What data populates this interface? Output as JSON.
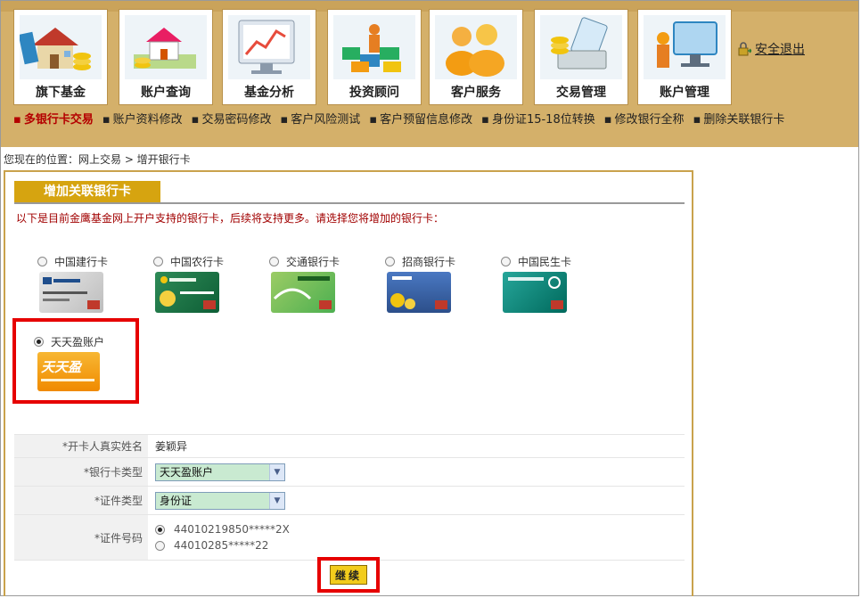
{
  "nav": {
    "tabs": [
      {
        "label": "旗下基金",
        "icon": "fund-house-icon"
      },
      {
        "label": "账户查询",
        "icon": "account-query-icon"
      },
      {
        "label": "基金分析",
        "icon": "chart-analysis-icon"
      },
      {
        "label": "投资顾问",
        "icon": "advisor-icon"
      },
      {
        "label": "客户服务",
        "icon": "customer-service-icon"
      },
      {
        "label": "交易管理",
        "icon": "trade-management-icon"
      },
      {
        "label": "账户管理",
        "icon": "account-management-icon"
      }
    ],
    "logout": "安全退出",
    "sub_items": [
      "多银行卡交易",
      "账户资料修改",
      "交易密码修改",
      "客户风险测试",
      "客户预留信息修改",
      "身份证15-18位转换",
      "修改银行全称",
      "删除关联银行卡"
    ]
  },
  "breadcrumb": "您现在的位置：网上交易  > 增开银行卡",
  "section": {
    "title": "增加关联银行卡",
    "intro": "以下是目前金鹰基金网上开户支持的银行卡，后续将支持更多。请选择您将增加的银行卡："
  },
  "cards": [
    {
      "label": "中国建行卡",
      "selected": false
    },
    {
      "label": "中国农行卡",
      "selected": false
    },
    {
      "label": "交通银行卡",
      "selected": false
    },
    {
      "label": "招商银行卡",
      "selected": false
    },
    {
      "label": "中国民生卡",
      "selected": false
    },
    {
      "label": "天天盈账户",
      "selected": true,
      "logo_text": "天天盈"
    }
  ],
  "form": {
    "name_label": "*开卡人真实姓名",
    "name_value": "姜颖异",
    "card_type_label": "*银行卡类型",
    "card_type_value": "天天盈账户",
    "id_type_label": "*证件类型",
    "id_type_value": "身份证",
    "id_number_label": "*证件号码",
    "id_numbers": [
      "44010219850*****2X",
      "44010285*****22"
    ],
    "submit": "继续"
  },
  "colors": {
    "header_bg": "#d4b06a",
    "accent_red": "#b40000",
    "title_bar": "#d6a410",
    "highlight": "#e60000"
  }
}
